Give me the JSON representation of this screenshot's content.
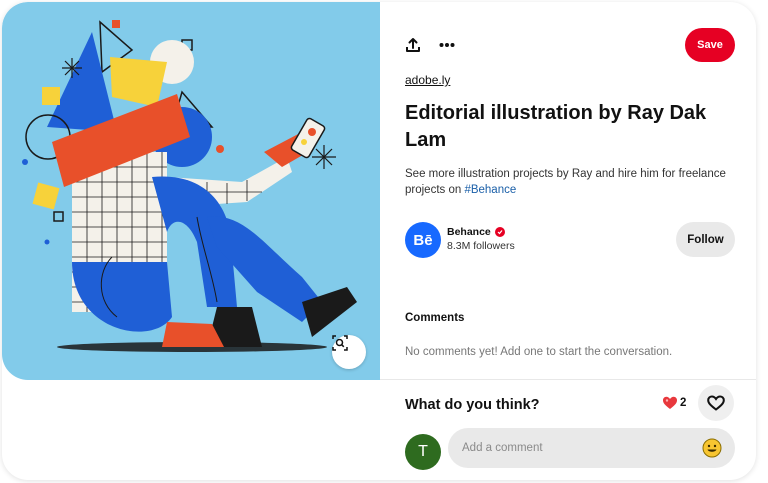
{
  "pin": {
    "source": "adobe.ly",
    "title": "Editorial illustration by Ray Dak Lam",
    "description_text": "See more illustration projects by Ray and hire him for freelance projects on ",
    "hashtag": "#Behance"
  },
  "toolbar": {
    "save_label": "Save",
    "share_icon": "share-icon",
    "more_icon": "more-options-icon"
  },
  "creator": {
    "avatar_text": "Bē",
    "name": "Behance",
    "followers": "8.3M followers",
    "follow_label": "Follow"
  },
  "comments": {
    "heading": "Comments",
    "empty_text": "No comments yet! Add one to start the conversation."
  },
  "footer": {
    "prompt": "What do you think?",
    "reaction_count": "2",
    "user_initial": "T",
    "comment_placeholder": "Add a comment"
  },
  "colors": {
    "save": "#e60023",
    "illustration_bg": "#82cbea",
    "creator_avatar": "#1769ff",
    "user_avatar": "#2e6b1f"
  }
}
